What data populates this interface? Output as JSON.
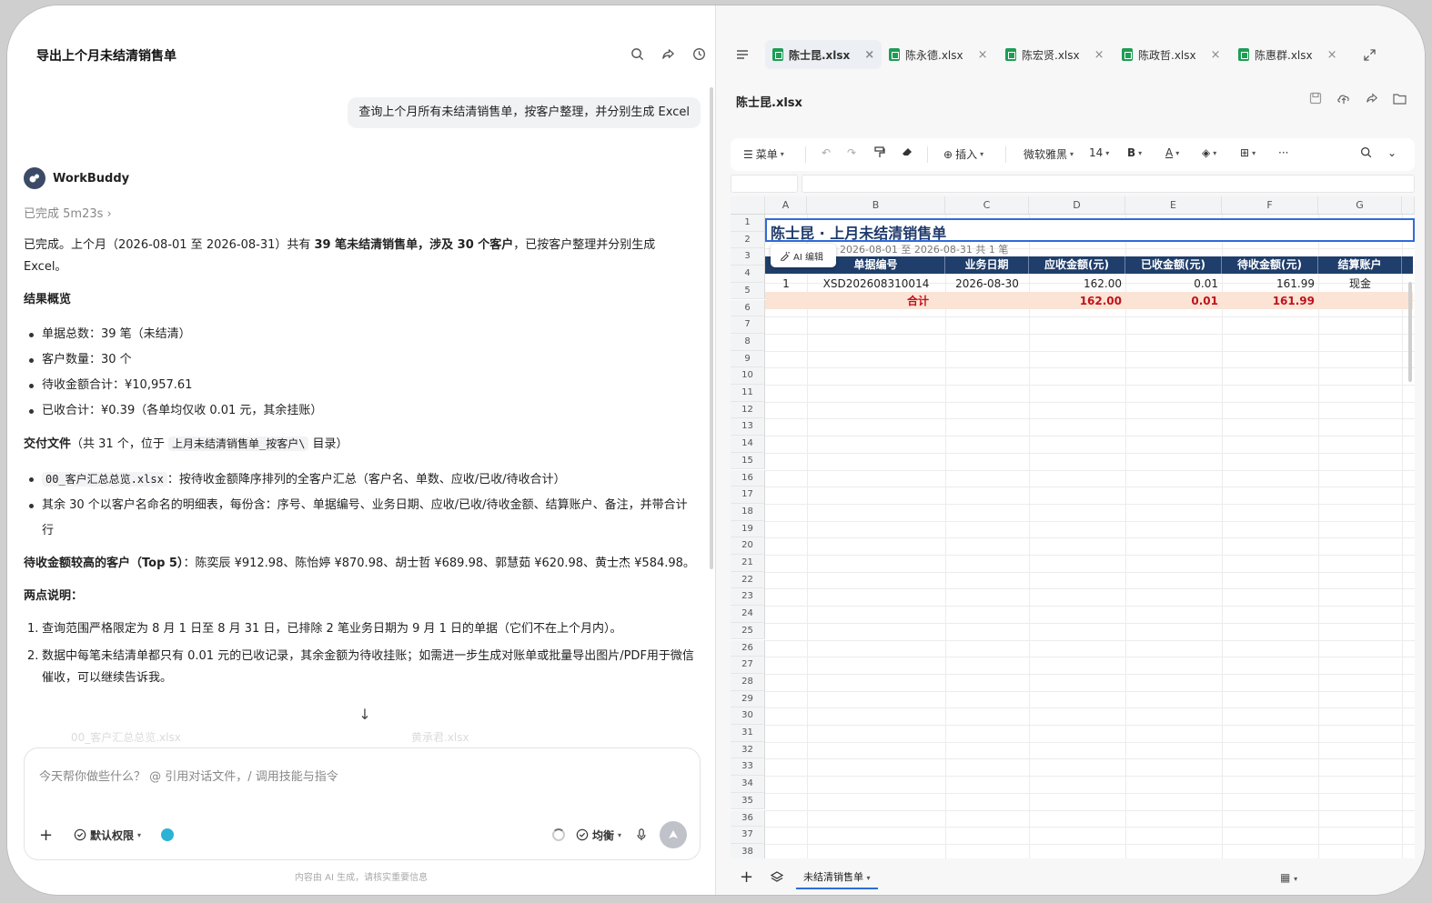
{
  "chat": {
    "title": "导出上个月未结清销售单",
    "user_message": "查询上个月所有未结清销售单，按客户整理，并分别生成 Excel",
    "bot_name": "WorkBuddy",
    "status": "已完成 5m23s",
    "intro_a": "已完成。上个月（2026-08-01 至 2026-08-31）共有 ",
    "intro_b": "39 笔未结清销售单，涉及 30 个客户",
    "intro_c": "，已按客户整理并分别生成 Excel。",
    "overview_title": "结果概览",
    "overview": [
      "单据总数：39 笔（未结清）",
      "客户数量：30 个",
      "待收金额合计：¥10,957.61",
      "已收合计：¥0.39（各单均仅收 0.01 元，其余挂账）"
    ],
    "deliver_title": "交付文件",
    "deliver_note": "（共 31 个，位于 ",
    "deliver_dir": "上月未结清销售单_按客户\\",
    "deliver_note_end": " 目录）",
    "deliver_file": "00_客户汇总总览.xlsx",
    "deliver_item1": "：按待收金额降序排列的全客户汇总（客户名、单数、应收/已收/待收合计）",
    "deliver_item2": "其余 30 个以客户名命名的明细表，每份含：序号、单据编号、业务日期、应收/已收/待收金额、结算账户、备注，并带合计行",
    "top_title": "待收金额较高的客户（Top 5）",
    "top_text": "：陈奕辰 ¥912.98、陈怡婷 ¥870.98、胡士哲 ¥689.98、郭慧茹 ¥620.98、黄士杰 ¥584.98。",
    "notes_title": "两点说明：",
    "notes": [
      "查询范围严格限定为 8 月 1 日至 8 月 31 日，已排除 2 笔业务日期为 9 月 1 日的单据（它们不在上个月内）。",
      "数据中每笔未结清单都只有 0.01 元的已收记录，其余金额为待收挂账；如需进一步生成对账单或批量导出图片/PDF用于微信催收，可以继续告诉我。"
    ],
    "file_strip": [
      "00_客户汇总总览.xlsx",
      "黄承君.xlsx"
    ],
    "composer_placeholder": "今天帮你做些什么？ @ 引用对话文件，/ 调用技能与指令",
    "permission_label": "默认权限",
    "mode_label": "均衡",
    "footer": "内容由 AI 生成，请核实重要信息"
  },
  "panel": {
    "tabs": [
      "陈士昆.xlsx",
      "陈永德.xlsx",
      "陈宏贤.xlsx",
      "陈政哲.xlsx",
      "陈惠群.xlsx"
    ],
    "active_tab": 0,
    "file_name": "陈士昆.xlsx",
    "toolbar": {
      "menu": "菜单",
      "insert": "插入",
      "font": "微软雅黑",
      "size": "14",
      "bold": "B",
      "text_color": "A",
      "more": "···"
    },
    "sheet_tab": "未结清销售单"
  },
  "sheet": {
    "columns": [
      "A",
      "B",
      "C",
      "D",
      "E",
      "F",
      "G"
    ],
    "title": "陈士昆 · 上月未结清销售单",
    "subtitle": "2026-08-01 至 2026-08-31   共 1 笔",
    "ai_edit": "AI 编辑",
    "headers": [
      "单据编号",
      "业务日期",
      "应收金额(元)",
      "已收金额(元)",
      "待收金额(元)",
      "结算账户"
    ],
    "row": {
      "seq": "1",
      "doc_no": "XSD202608310014",
      "date": "2026-08-30",
      "receivable": "162.00",
      "received": "0.01",
      "pending": "161.99",
      "account": "现金"
    },
    "total": {
      "label": "合计",
      "receivable": "162.00",
      "received": "0.01",
      "pending": "161.99"
    },
    "row_count": 38
  },
  "colors": {
    "accent": "#2f6bd9",
    "header_bg": "#1f3e6b",
    "total_bg": "#fbe4d6",
    "total_text": "#c0121c",
    "xlsx_green": "#1d9e55"
  }
}
